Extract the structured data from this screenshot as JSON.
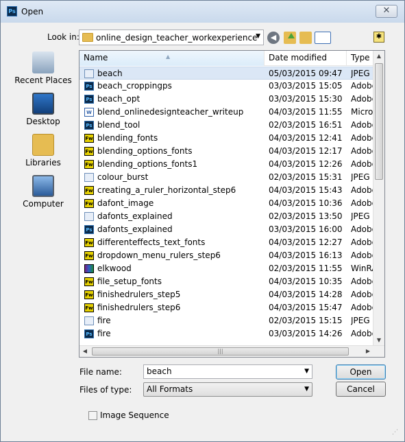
{
  "window": {
    "title": "Open",
    "app_icon": "Ps",
    "close_icon": "close-icon"
  },
  "lookin": {
    "label": "Look in:",
    "value": "online_design_teacher_workexperience"
  },
  "places": [
    {
      "label": "Recent Places",
      "icon": "recent-places-icon"
    },
    {
      "label": "Desktop",
      "icon": "desktop-icon"
    },
    {
      "label": "Libraries",
      "icon": "libraries-icon"
    },
    {
      "label": "Computer",
      "icon": "computer-icon"
    }
  ],
  "list": {
    "columns": [
      "Name",
      "Date modified",
      "Type"
    ],
    "rows": [
      {
        "icon": "jpeg",
        "name": "beach",
        "date": "05/03/2015 09:47",
        "type": "JPEG image"
      },
      {
        "icon": "ps",
        "name": "beach_croppingps",
        "date": "03/03/2015 15:05",
        "type": "Adobe"
      },
      {
        "icon": "ps",
        "name": "beach_opt",
        "date": "03/03/2015 15:30",
        "type": "Adobe"
      },
      {
        "icon": "doc",
        "name": "blend_onlinedesignteacher_writeup",
        "date": "04/03/2015 11:55",
        "type": "Microsoft"
      },
      {
        "icon": "ps",
        "name": "blend_tool",
        "date": "02/03/2015 16:51",
        "type": "Adobe"
      },
      {
        "icon": "fw",
        "name": "blending_fonts",
        "date": "04/03/2015 12:41",
        "type": "Adobe"
      },
      {
        "icon": "fw",
        "name": "blending_options_fonts",
        "date": "04/03/2015 12:17",
        "type": "Adobe"
      },
      {
        "icon": "fw",
        "name": "blending_options_fonts1",
        "date": "04/03/2015 12:26",
        "type": "Adobe"
      },
      {
        "icon": "jpeg",
        "name": "colour_burst",
        "date": "02/03/2015 15:31",
        "type": "JPEG image"
      },
      {
        "icon": "fw",
        "name": "creating_a_ruler_horizontal_step6",
        "date": "04/03/2015 15:43",
        "type": "Adobe"
      },
      {
        "icon": "fw",
        "name": "dafont_image",
        "date": "04/03/2015 10:36",
        "type": "Adobe"
      },
      {
        "icon": "jpeg",
        "name": "dafonts_explained",
        "date": "02/03/2015 13:50",
        "type": "JPEG image"
      },
      {
        "icon": "ps",
        "name": "dafonts_explained",
        "date": "03/03/2015 16:00",
        "type": "Adobe"
      },
      {
        "icon": "fw",
        "name": "differenteffects_text_fonts",
        "date": "04/03/2015 12:27",
        "type": "Adobe"
      },
      {
        "icon": "fw",
        "name": "dropdown_menu_rulers_step6",
        "date": "04/03/2015 16:13",
        "type": "Adobe"
      },
      {
        "icon": "rar",
        "name": "elkwood",
        "date": "02/03/2015 11:55",
        "type": "WinRAR"
      },
      {
        "icon": "fw",
        "name": "file_setup_fonts",
        "date": "04/03/2015 10:35",
        "type": "Adobe"
      },
      {
        "icon": "fw",
        "name": "finishedrulers_step5",
        "date": "04/03/2015 14:28",
        "type": "Adobe"
      },
      {
        "icon": "fw",
        "name": "finishedrulers_step6",
        "date": "04/03/2015 15:47",
        "type": "Adobe"
      },
      {
        "icon": "jpeg",
        "name": "fire",
        "date": "02/03/2015 15:15",
        "type": "JPEG image"
      },
      {
        "icon": "ps",
        "name": "fire",
        "date": "03/03/2015 14:26",
        "type": "Adobe"
      }
    ]
  },
  "file_name": {
    "label": "File name:",
    "value": "beach"
  },
  "file_type": {
    "label": "Files of type:",
    "value": "All Formats"
  },
  "buttons": {
    "open": "Open",
    "cancel": "Cancel"
  },
  "image_sequence": {
    "label": "Image Sequence",
    "checked": false
  }
}
